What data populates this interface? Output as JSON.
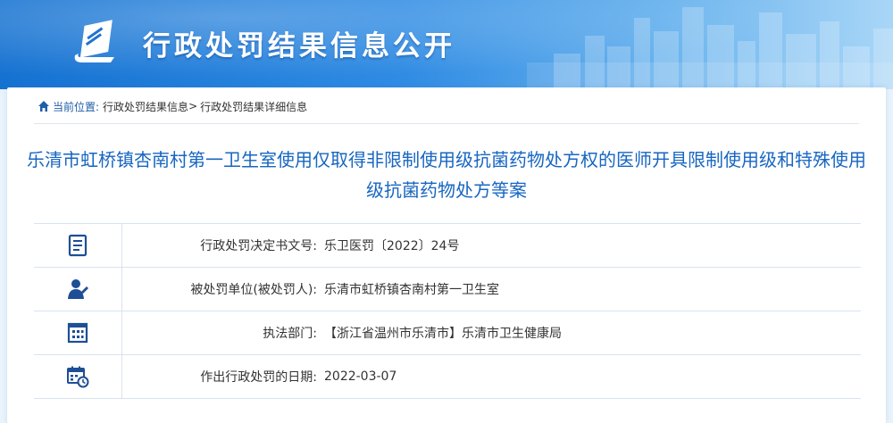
{
  "banner": {
    "title": "行政处罚结果信息公开"
  },
  "breadcrumb": {
    "prefix": "当前位置:",
    "items": [
      "行政处罚结果信息",
      "行政处罚结果详细信息"
    ],
    "separator": ">"
  },
  "document": {
    "title": "乐清市虹桥镇杏南村第一卫生室使用仅取得非限制使用级抗菌药物处方权的医师开具限制使用级和特殊使用级抗菌药物处方等案"
  },
  "details": [
    {
      "icon": "document-list-icon",
      "label": "行政处罚决定书文号:",
      "value": "乐卫医罚〔2022〕24号"
    },
    {
      "icon": "person-icon",
      "label": "被处罚单位(被处罚人):",
      "value": "乐清市虹桥镇杏南村第一卫生室"
    },
    {
      "icon": "building-icon",
      "label": "执法部门:",
      "value": "【浙江省温州市乐清市】乐清市卫生健康局"
    },
    {
      "icon": "calendar-clock-icon",
      "label": "作出行政处罚的日期:",
      "value": "2022-03-07"
    }
  ],
  "colors": {
    "accent": "#1766c1",
    "banner_start": "#1672d1",
    "banner_end": "#a9d6f7",
    "icon": "#1e4e96"
  }
}
